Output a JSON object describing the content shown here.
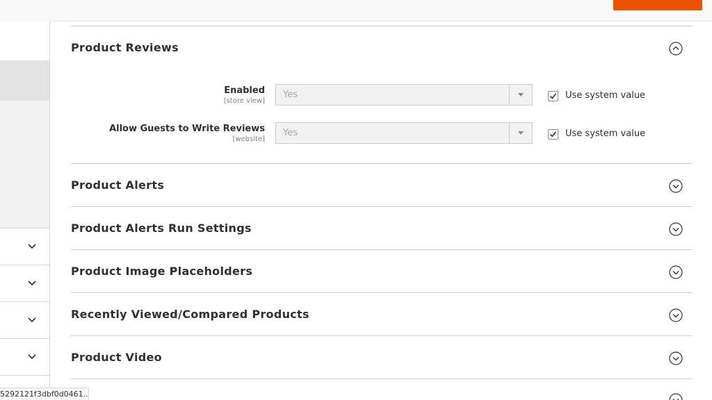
{
  "sections": {
    "product_reviews": "Product Reviews",
    "product_alerts": "Product Alerts",
    "product_alerts_run": "Product Alerts Run Settings",
    "image_placeholders": "Product Image Placeholders",
    "recently_viewed": "Recently Viewed/Compared Products",
    "product_video": "Product Video"
  },
  "fields": [
    {
      "label": "Enabled",
      "scope": "[store view]",
      "value": "Yes",
      "use_system": "Use system value"
    },
    {
      "label": "Allow Guests to Write Reviews",
      "scope": "[website]",
      "value": "Yes",
      "use_system": "Use system value"
    }
  ],
  "status_bar": {
    "text": "5292121f3dbf0d0461..."
  },
  "icons": {
    "collapse": "chevron-up-circle-icon",
    "expand": "chevron-down-circle-icon",
    "sidebar": "chevron-down-icon",
    "check": "check-icon"
  },
  "colors": {
    "accent": "#eb5202",
    "text": "#303030"
  }
}
